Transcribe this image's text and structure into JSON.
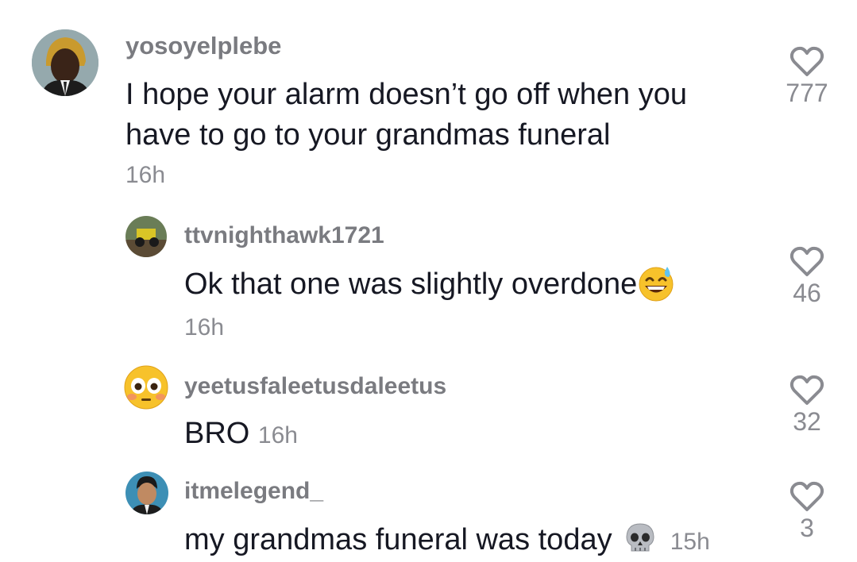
{
  "comments": [
    {
      "username": "yosoyelplebe",
      "text": "I hope your alarm doesn’t go off when you have to go to your grandmas funeral",
      "time": "16h",
      "likes": "777",
      "avatar_icon": "man-portrait-avatar"
    },
    {
      "username": "ttvnighthawk1721",
      "text": "Ok that one was slightly overdone",
      "emoji": "grinning-sweat-emoji",
      "time": "16h",
      "likes": "46",
      "avatar_icon": "jeep-offroad-avatar"
    },
    {
      "username": "yeetusfaleetusdaleetus",
      "text": "BRO",
      "time": "16h",
      "likes": "32",
      "avatar_icon": "flushed-face-emoji-avatar"
    },
    {
      "username": "itmelegend_",
      "text": "my grandmas funeral was today",
      "emoji": "skull-emoji",
      "time": "15h",
      "likes": "3",
      "avatar_icon": "cartoon-man-avatar"
    }
  ],
  "colors": {
    "username": "#7a7b80",
    "text": "#161823",
    "muted": "#8a8b91"
  }
}
